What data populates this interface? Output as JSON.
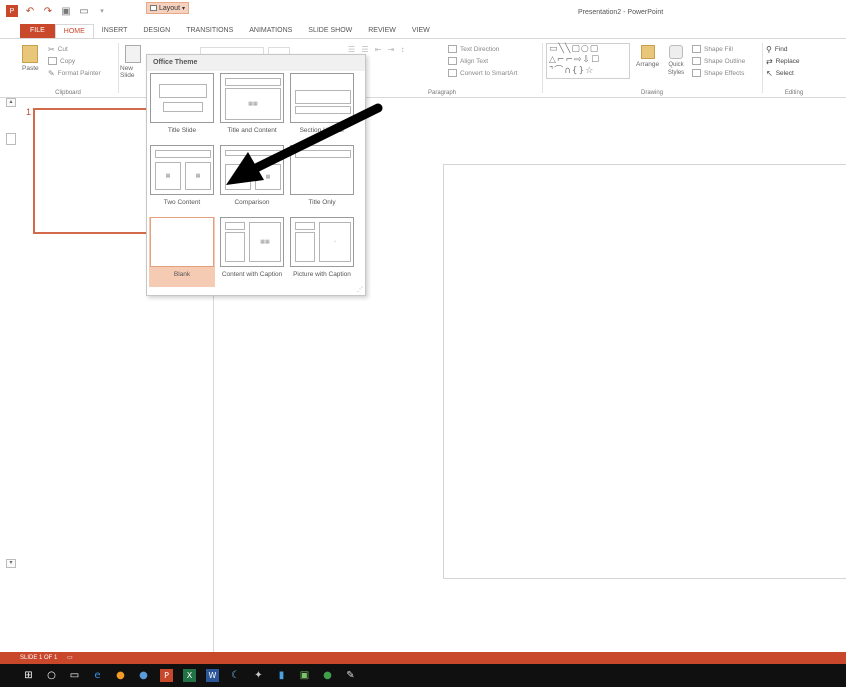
{
  "app": {
    "title": "Presentation2 - PowerPoint"
  },
  "tabs": [
    "FILE",
    "HOME",
    "INSERT",
    "DESIGN",
    "TRANSITIONS",
    "ANIMATIONS",
    "SLIDE SHOW",
    "REVIEW",
    "VIEW"
  ],
  "ribbon": {
    "clipboard": {
      "paste": "Paste",
      "cut": "Cut",
      "copy": "Copy",
      "format_painter": "Format Painter",
      "label": "Clipboard"
    },
    "slides": {
      "new_slide": "New Slide",
      "layout": "Layout"
    },
    "paragraph": {
      "text_direction": "Text Direction",
      "align_text": "Align Text",
      "convert_smartart": "Convert to SmartArt",
      "label": "Paragraph"
    },
    "drawing": {
      "arrange": "Arrange",
      "quick_styles": "Quick Styles",
      "shape_fill": "Shape Fill",
      "shape_outline": "Shape Outline",
      "shape_effects": "Shape Effects",
      "label": "Drawing"
    },
    "editing": {
      "find": "Find",
      "replace": "Replace",
      "select": "Select",
      "label": "Editing"
    }
  },
  "layout_menu": {
    "header": "Office Theme",
    "items": [
      {
        "name": "Title Slide"
      },
      {
        "name": "Title and Content"
      },
      {
        "name": "Section Header"
      },
      {
        "name": "Two Content"
      },
      {
        "name": "Comparison"
      },
      {
        "name": "Title Only"
      },
      {
        "name": "Blank",
        "selected": true
      },
      {
        "name": "Content with Caption"
      },
      {
        "name": "Picture with Caption"
      }
    ]
  },
  "thumbnails": {
    "slide_number": "1"
  },
  "status": {
    "slide_info": "SLIDE 1 OF 1"
  },
  "colors": {
    "accent": "#c9472b",
    "selection": "#f6cbb3"
  },
  "taskbar_icons": [
    "windows-start-icon",
    "search-icon",
    "task-view-icon",
    "edge-icon",
    "firefox-icon",
    "chrome-icon",
    "powerpoint-icon",
    "excel-icon",
    "word-icon",
    "app-icon",
    "app-icon",
    "app-icon",
    "app-icon",
    "app-icon",
    "app-icon"
  ]
}
